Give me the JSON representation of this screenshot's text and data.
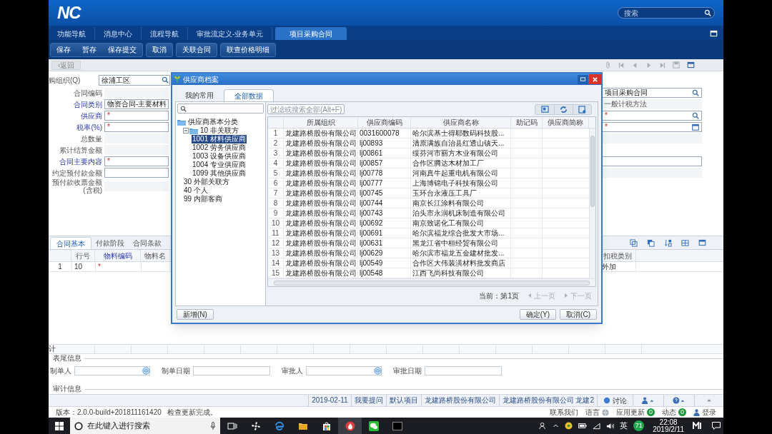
{
  "header": {
    "logo": "NC",
    "search_placeholder": "搜索"
  },
  "nav_tabs": [
    {
      "label": "功能导航",
      "selected": false
    },
    {
      "label": "消息中心",
      "selected": false
    },
    {
      "label": "流程导航",
      "selected": false
    },
    {
      "label": "审批流定义-业务单元",
      "selected": false
    },
    {
      "label": "项目采购合同",
      "selected": true
    }
  ],
  "toolbar": [
    [
      "保存",
      "暂存",
      "保存提交"
    ],
    [
      "取消"
    ],
    [
      "关联合同"
    ],
    [
      "联查价格明细"
    ]
  ],
  "back_button": "‹返回",
  "form": {
    "org": {
      "label": "购组织(Q)",
      "value": "徐浦工区"
    },
    "fields": [
      {
        "label": "合同编码",
        "required": false,
        "kind": "readonly",
        "side": {
          "kind": "search",
          "value": "项目采购合同"
        }
      },
      {
        "label": "合同类别",
        "required": true,
        "kind": "input",
        "value": "物资合同-主要材料",
        "side": {
          "kind": "readonly",
          "value": "一般计税方法"
        }
      },
      {
        "label": "供应商",
        "required": true,
        "kind": "input",
        "marker": "*",
        "side": {
          "kind": "search",
          "marker": "*"
        }
      },
      {
        "label": "税率(%)",
        "required": true,
        "kind": "input",
        "marker": "*",
        "side": {
          "kind": "calendar",
          "marker": "*"
        }
      },
      {
        "label": "总数量",
        "required": false,
        "kind": "readonly",
        "side": {
          "kind": "readonly"
        }
      },
      {
        "label": "累计结算金额",
        "required": false,
        "kind": "readonly"
      },
      {
        "label": "合同主要内容",
        "required": true,
        "kind": "input",
        "marker": "*",
        "side": {
          "kind": "input"
        }
      },
      {
        "label": "约定预付款金额",
        "required": false,
        "kind": "input",
        "side": {
          "kind": "readonly"
        }
      },
      {
        "label": "预付款收票金额(含税)",
        "required": false,
        "kind": "readonly"
      }
    ]
  },
  "detail": {
    "tabs": [
      {
        "label": "合同基本",
        "selected": true
      },
      {
        "label": "付款阶段",
        "selected": false
      },
      {
        "label": "合同条款",
        "selected": false
      }
    ],
    "columns": [
      {
        "label": "行号",
        "required": false
      },
      {
        "label": "物料编码",
        "required": true
      },
      {
        "label": "物料名",
        "required": false
      }
    ],
    "right_column": "扣税类别",
    "rows": [
      {
        "row_no": "1",
        "line": "10",
        "material_code": "*",
        "tax_type": "外加"
      }
    ],
    "total_label": "计"
  },
  "footer_info": {
    "title": "表尾信息",
    "fields": [
      {
        "label": "制单人",
        "kind": "ref"
      },
      {
        "label": "制单日期",
        "kind": "date"
      },
      {
        "label": "审批人",
        "kind": "ref"
      },
      {
        "label": "审批日期",
        "kind": "date"
      }
    ],
    "audit_title": "审计信息"
  },
  "status_bar": {
    "items": [
      "2019-02-11",
      "我要提问",
      "默认项目",
      "龙建路桥股份有限公司",
      "龙建路桥股份有限公司 龙建2"
    ],
    "discuss": "讨论"
  },
  "version_bar": {
    "version": "版本：2.0.0-build+201811161420",
    "message": "检查更新完成。",
    "links": [
      {
        "label": "联系我们",
        "kind": "plain"
      },
      {
        "label": "语言",
        "kind": "globe"
      },
      {
        "label": "应用更新",
        "kind": "badge",
        "badge": "0"
      },
      {
        "label": "动态",
        "kind": "badge",
        "badge": "0"
      },
      {
        "label": "登录",
        "kind": "user"
      }
    ]
  },
  "taskbar": {
    "search_placeholder": "在此键入进行搜索",
    "ime": "英",
    "badge": "71",
    "time": "22:08",
    "date": "2019/2/11"
  },
  "dialog": {
    "title": "供应商档案",
    "tabs": [
      {
        "label": "我的常用",
        "selected": false
      },
      {
        "label": "全部数据",
        "selected": true
      }
    ],
    "tree": [
      {
        "label": "供应商基本分类",
        "selected": false,
        "children": [
          {
            "label": "10 非关联方",
            "selected": false,
            "expanded": true,
            "children": [
              {
                "label": "1001 材料供应商",
                "selected": true
              },
              {
                "label": "1002 劳务供应商",
                "selected": false
              },
              {
                "label": "1003 设备供应商",
                "selected": false
              },
              {
                "label": "1004 专业供应商",
                "selected": false
              },
              {
                "label": "1099 其他供应商",
                "selected": false
              }
            ]
          },
          {
            "label": "30 外部关联方",
            "selected": false
          },
          {
            "label": "40 个人",
            "selected": false
          },
          {
            "label": "99 内部客商",
            "selected": false
          }
        ]
      }
    ],
    "filter_placeholder": "过滤或搜索全部(Alt+F)",
    "columns": [
      "所属组织",
      "供应商编码",
      "供应商名称",
      "助记码",
      "供应商简称"
    ],
    "rows": [
      {
        "no": "1",
        "org": "龙建路桥股份有限公司",
        "code": "0031600078",
        "name": "哈尔滨基士得耶数码科技股..."
      },
      {
        "no": "2",
        "org": "龙建路桥股份有限公司",
        "code": "lj00893",
        "name": "清原满族自治县红透山镇天..."
      },
      {
        "no": "3",
        "org": "龙建路桥股份有限公司",
        "code": "lj00861",
        "name": "绥芬河市丽方木业有限公司"
      },
      {
        "no": "4",
        "org": "龙建路桥股份有限公司",
        "code": "lj00857",
        "name": "合作区腾达木材加工厂"
      },
      {
        "no": "5",
        "org": "龙建路桥股份有限公司",
        "code": "lj00778",
        "name": "河南真牛起重电机有限公司"
      },
      {
        "no": "6",
        "org": "龙建路桥股份有限公司",
        "code": "lj00777",
        "name": "上海博锦电子科技有限公司"
      },
      {
        "no": "7",
        "org": "龙建路桥股份有限公司",
        "code": "lj00745",
        "name": "玉环台永液压工具厂"
      },
      {
        "no": "8",
        "org": "龙建路桥股份有限公司",
        "code": "lj00744",
        "name": "南京长江涂料有限公司"
      },
      {
        "no": "9",
        "org": "龙建路桥股份有限公司",
        "code": "lj00743",
        "name": "泊头市永润机床制造有限公司"
      },
      {
        "no": "10",
        "org": "龙建路桥股份有限公司",
        "code": "lj00692",
        "name": "南京致诺化工有限公司"
      },
      {
        "no": "11",
        "org": "龙建路桥股份有限公司",
        "code": "lj00691",
        "name": "哈尔滨福龙综合批发大市场..."
      },
      {
        "no": "12",
        "org": "龙建路桥股份有限公司",
        "code": "lj00631",
        "name": "黑龙江省中桓经贸有限公司"
      },
      {
        "no": "13",
        "org": "龙建路桥股份有限公司",
        "code": "lj00629",
        "name": "哈尔滨市福龙五金建材批发..."
      },
      {
        "no": "14",
        "org": "龙建路桥股份有限公司",
        "code": "lj00549",
        "name": "合作区大伟装潢材料批发商店"
      },
      {
        "no": "15",
        "org": "龙建路桥股份有限公司",
        "code": "lj00548",
        "name": "江西飞尚科技有限公司"
      }
    ],
    "page_info": "当前：第1页",
    "prev": {
      "label": "上一页",
      "disabled": true
    },
    "next": {
      "label": "下一页",
      "disabled": true
    },
    "new_button": "新增(N)",
    "ok_button": "确定(Y)",
    "cancel_button": "取消(C)"
  }
}
